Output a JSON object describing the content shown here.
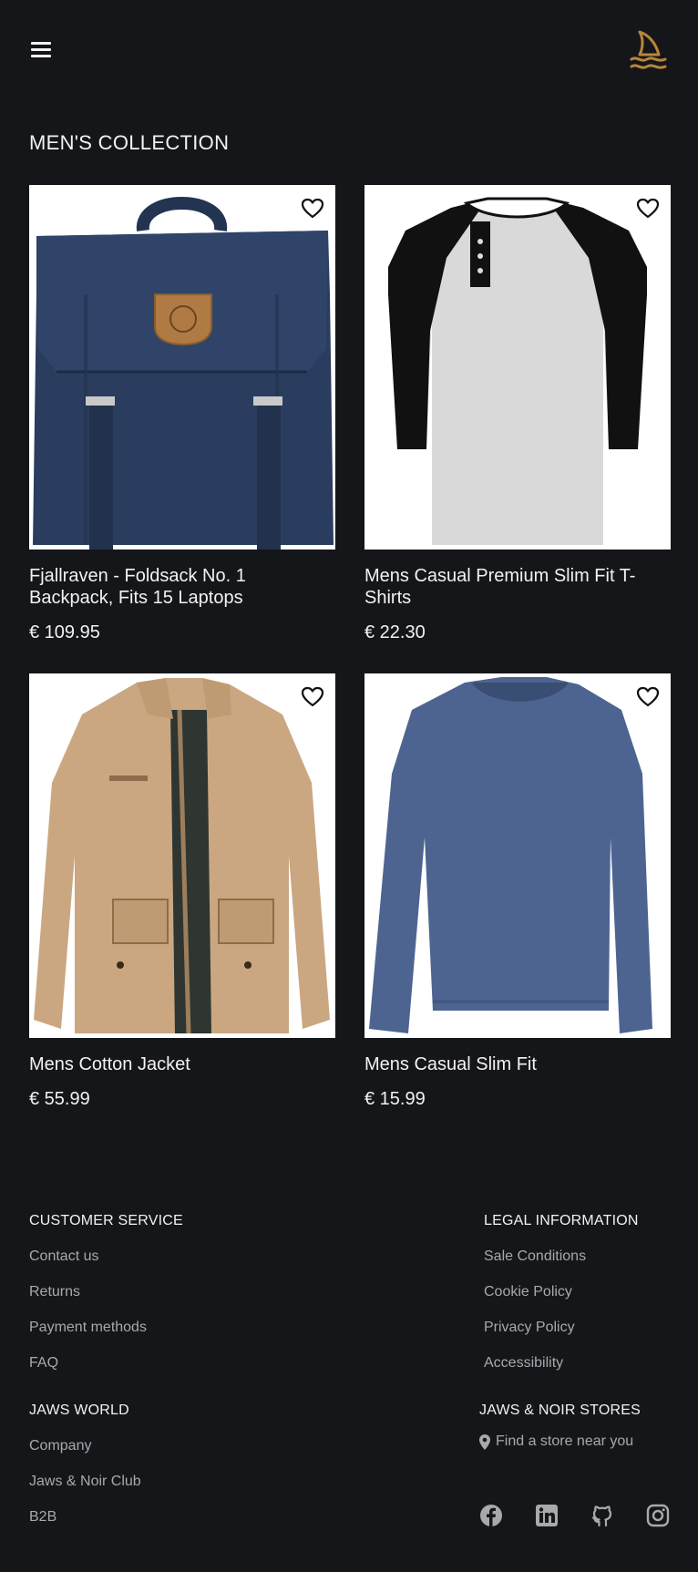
{
  "header": {
    "menu_icon": "hamburger-menu-icon",
    "logo_icon": "shark-fin-logo-icon",
    "logo_color": "#b8863b"
  },
  "section_title": "MEN'S COLLECTION",
  "products": [
    {
      "name": "Fjallraven - Foldsack No. 1 Backpack, Fits 15 Laptops",
      "price": "€ 109.95",
      "image": "navy-backpack"
    },
    {
      "name": "Mens Casual Premium Slim Fit T-Shirts",
      "price": "€ 22.30",
      "image": "raglan-henley-tshirt"
    },
    {
      "name": "Mens Cotton Jacket",
      "price": "€ 55.99",
      "image": "khaki-cotton-jacket"
    },
    {
      "name": "Mens Casual Slim Fit",
      "price": "€ 15.99",
      "image": "blue-longsleeve-tshirt"
    }
  ],
  "footer": {
    "customer_service": {
      "title": "CUSTOMER SERVICE",
      "links": [
        "Contact us",
        "Returns",
        "Payment methods",
        "FAQ"
      ]
    },
    "legal": {
      "title": "LEGAL INFORMATION",
      "links": [
        "Sale Conditions",
        "Cookie Policy",
        "Privacy Policy",
        "Accessibility"
      ]
    },
    "world": {
      "title": "JAWS WORLD",
      "links": [
        "Company",
        "Jaws & Noir Club",
        "B2B"
      ]
    },
    "stores": {
      "title": "JAWS & NOIR STORES",
      "find_store": "Find a store near you",
      "find_icon": "map-pin-icon"
    },
    "socials": [
      "facebook-icon",
      "linkedin-icon",
      "github-icon",
      "instagram-icon"
    ]
  },
  "colors": {
    "background": "#15161a",
    "text": "#f2f2f2",
    "muted": "#a8a9ad",
    "accent": "#b8863b"
  }
}
